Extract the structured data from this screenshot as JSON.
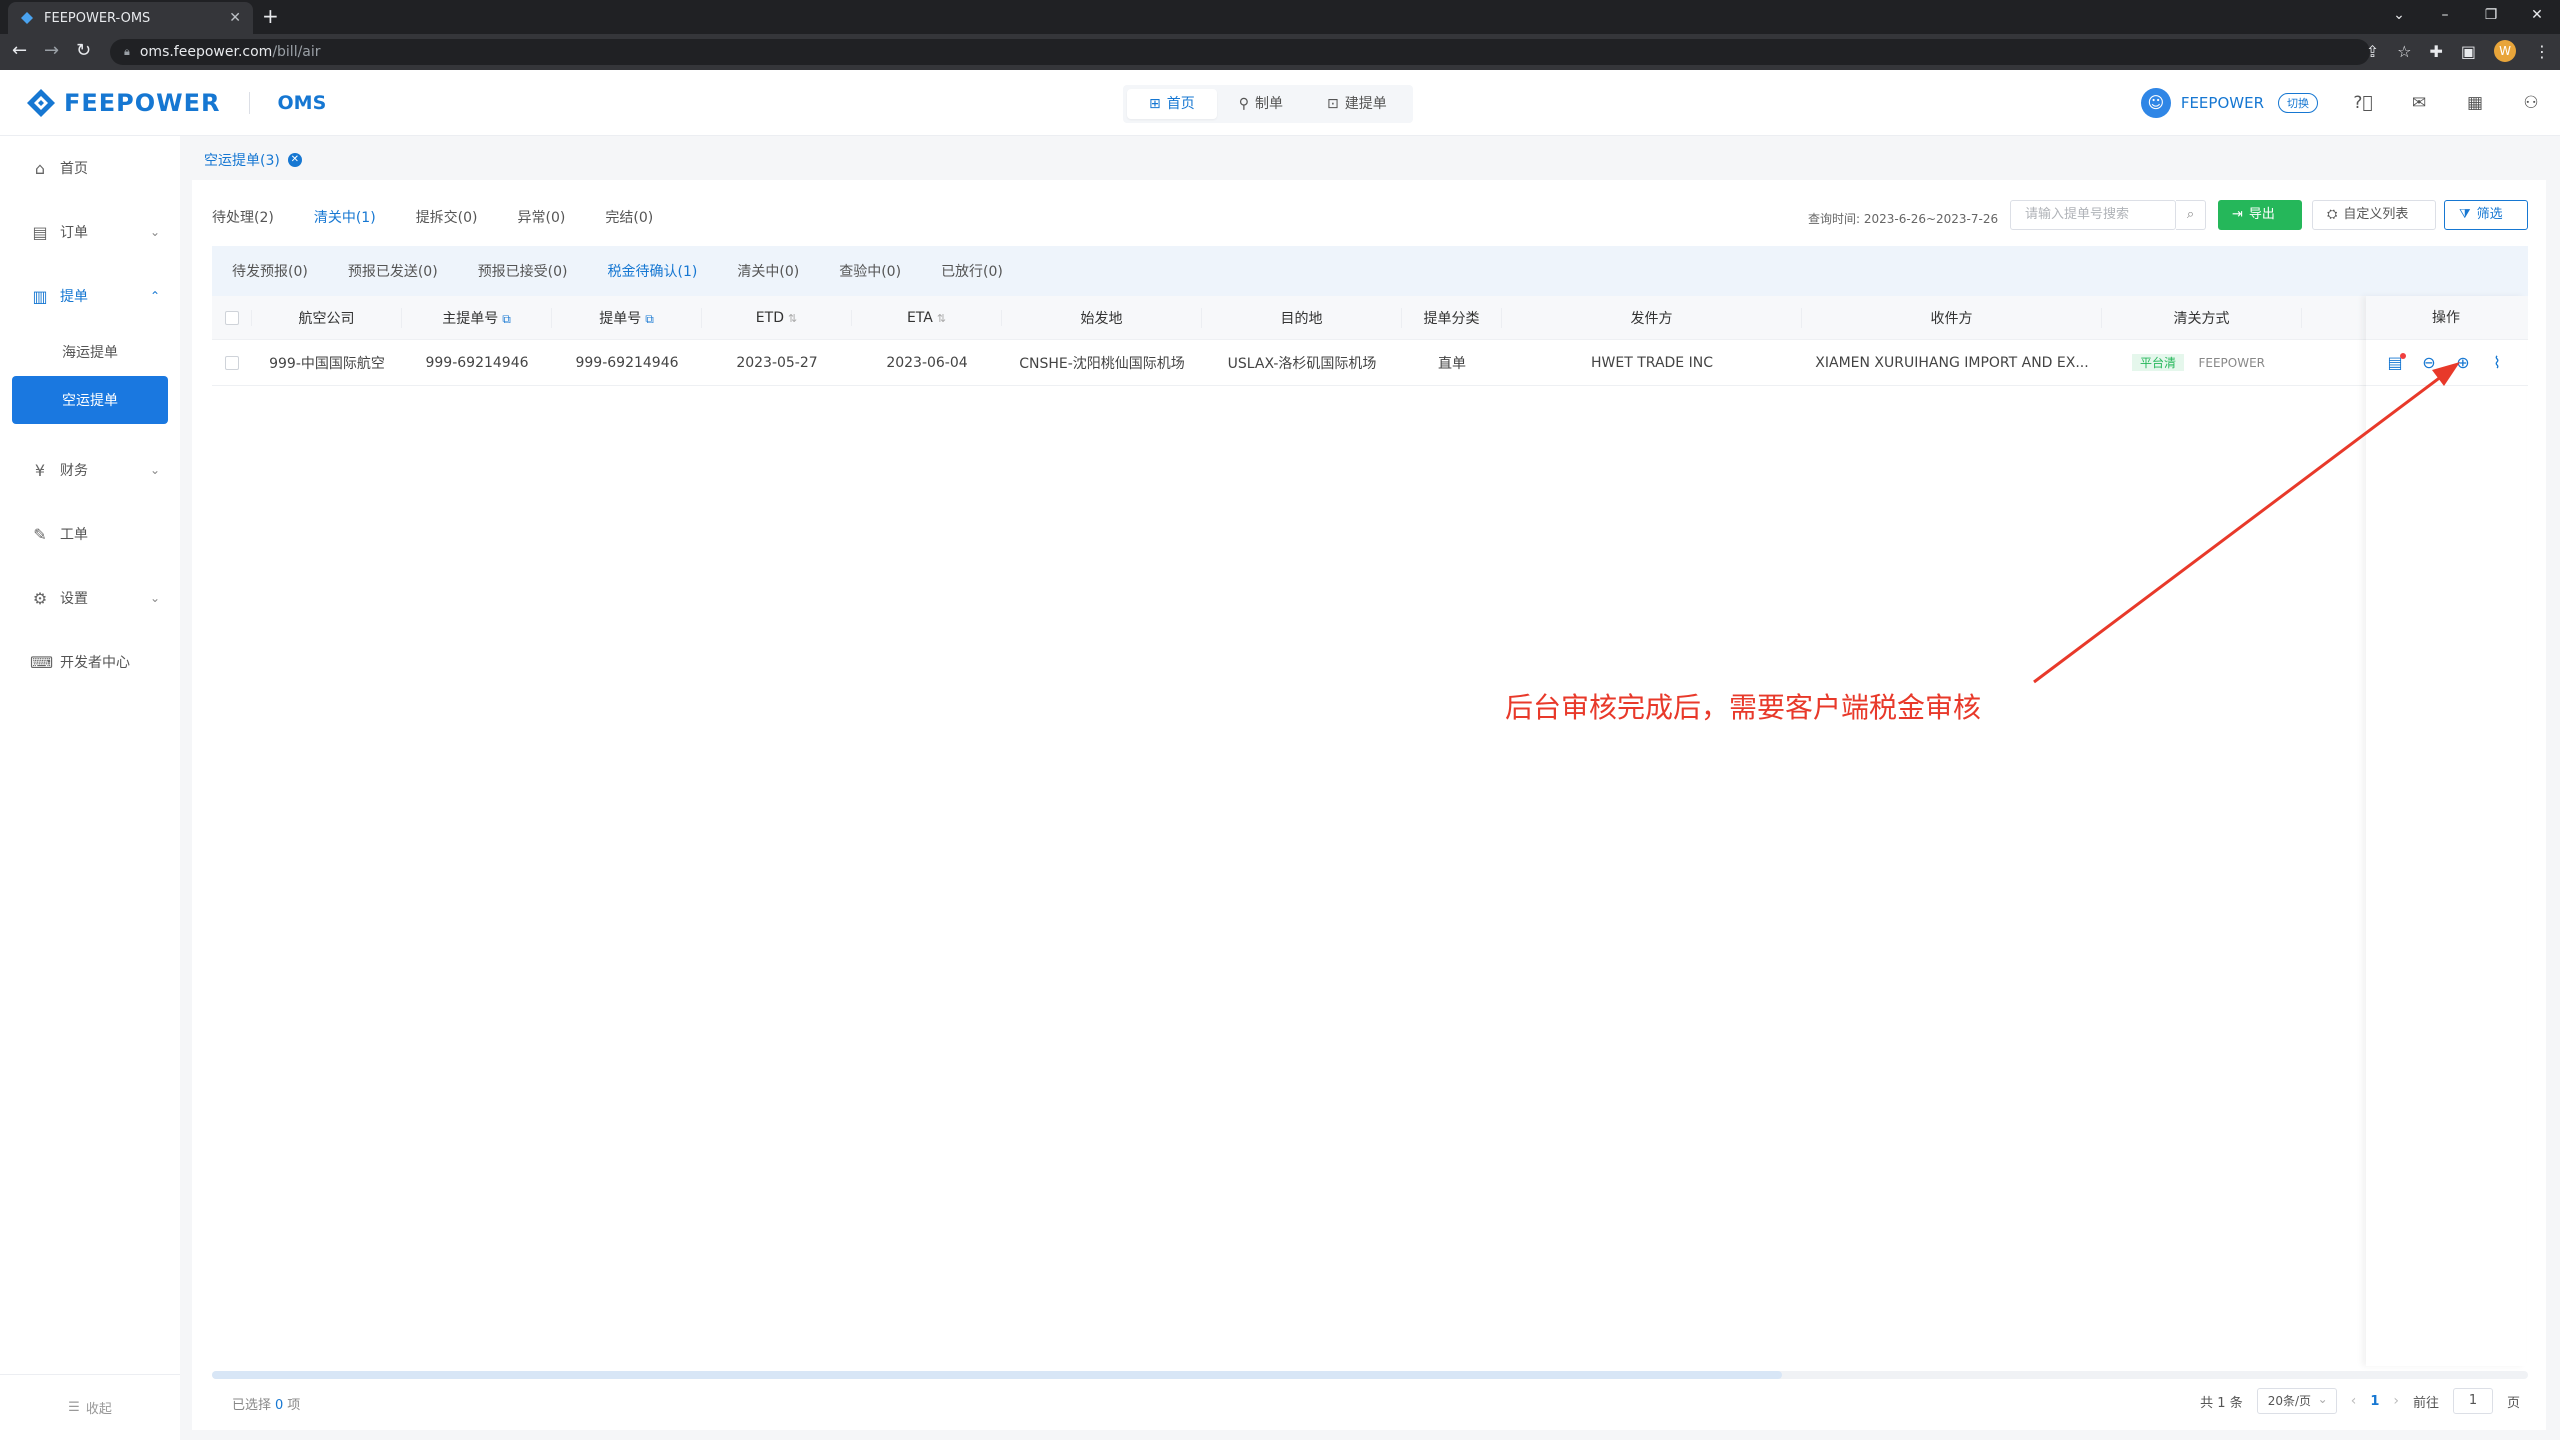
{
  "browser": {
    "tab_title": "FEEPOWER-OMS",
    "url_host": "oms.feepower.com",
    "url_path": "/bill/air",
    "profile_initial": "W"
  },
  "header": {
    "brand": "FEEPOWER",
    "product": "OMS",
    "nav": [
      {
        "label": "首页",
        "icon": "grid-icon"
      },
      {
        "label": "制单",
        "icon": "stamp-icon"
      },
      {
        "label": "建提单",
        "icon": "doc-add-icon"
      }
    ],
    "user_name": "FEEPOWER",
    "switch_label": "切换"
  },
  "sidebar": {
    "items": [
      {
        "label": "首页",
        "icon": "home-icon"
      },
      {
        "label": "订单",
        "icon": "order-icon"
      },
      {
        "label": "提单",
        "icon": "bill-icon"
      },
      {
        "label": "财务",
        "icon": "finance-icon"
      },
      {
        "label": "工单",
        "icon": "ticket-icon"
      },
      {
        "label": "设置",
        "icon": "settings-icon"
      },
      {
        "label": "开发者中心",
        "icon": "developer-icon"
      }
    ],
    "sub_items": [
      "海运提单",
      "空运提单"
    ],
    "collapse_label": "收起"
  },
  "page_tab": "空运提单(3)",
  "status_tabs": [
    "待处理(2)",
    "清关中(1)",
    "提拆交(0)",
    "异常(0)",
    "完结(0)"
  ],
  "toolbar": {
    "query_time": "查询时间: 2023-6-26~2023-7-26",
    "search_placeholder": "请输入提单号搜索",
    "export_label": "导出",
    "custom_list_label": "自定义列表",
    "filter_label": "筛选"
  },
  "sub_tabs": [
    "待发预报(0)",
    "预报已发送(0)",
    "预报已接受(0)",
    "税金待确认(1)",
    "清关中(0)",
    "查验中(0)",
    "已放行(0)"
  ],
  "table": {
    "columns": [
      "航空公司",
      "主提单号",
      "提单号",
      "ETD",
      "ETA",
      "始发地",
      "目的地",
      "提单分类",
      "发件方",
      "收件方",
      "清关方式"
    ],
    "ops_header": "操作",
    "rows": [
      {
        "airline": "999-中国国际航空",
        "master_bill": "999-69214946",
        "bill_no": "999-69214946",
        "etd": "2023-05-27",
        "eta": "2023-06-04",
        "origin": "CNSHE-沈阳桃仙国际机场",
        "destination": "USLAX-洛杉矶国际机场",
        "category": "直单",
        "shipper": "HWET TRADE INC",
        "consignee": "XIAMEN XURUIHANG IMPORT AND EX...",
        "clearance_tag": "平台清",
        "clearance_broker": "FEEPOWER"
      }
    ]
  },
  "footer": {
    "selected_prefix": "已选择",
    "selected_count": "0",
    "selected_suffix": "项",
    "total": "共 1 条",
    "page_size": "20条/页",
    "current_page": "1",
    "goto_label": "前往",
    "goto_value": "1",
    "page_suffix": "页"
  },
  "annotation": "后台审核完成后，需要客户端税金审核",
  "colors": {
    "primary": "#1677d2",
    "export_green": "#25b75a",
    "annotation_red": "#e8392a"
  }
}
